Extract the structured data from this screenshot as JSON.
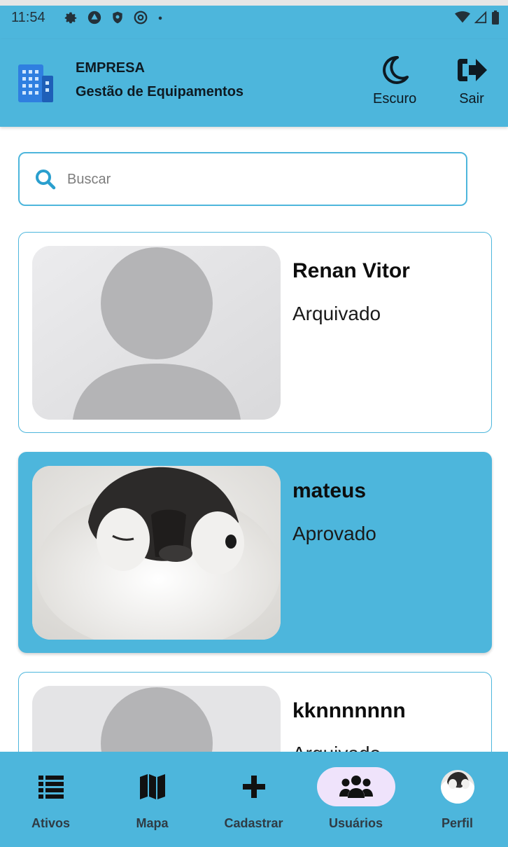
{
  "status_bar": {
    "time": "11:54"
  },
  "header": {
    "title": "EMPRESA",
    "subtitle": "Gestão de Equipamentos",
    "dark_label": "Escuro",
    "exit_label": "Sair"
  },
  "search": {
    "placeholder": "Buscar",
    "value": ""
  },
  "users": [
    {
      "name": "Renan Vitor",
      "status": "Arquivado",
      "avatar": "default-person"
    },
    {
      "name": "mateus",
      "status": "Aprovado",
      "avatar": "penguin-photo"
    },
    {
      "name": "kknnnnnnn",
      "status": "Arquivado",
      "avatar": "default-person"
    }
  ],
  "nav": {
    "items": [
      {
        "label": "Ativos",
        "icon": "list-icon"
      },
      {
        "label": "Mapa",
        "icon": "map-icon"
      },
      {
        "label": "Cadastrar",
        "icon": "plus-icon"
      },
      {
        "label": "Usuários",
        "icon": "users-icon"
      },
      {
        "label": "Perfil",
        "icon": "profile-avatar-icon"
      }
    ]
  },
  "colors": {
    "primary": "#4db6dc",
    "active_pill": "#efe3fb",
    "card_border": "#4db6dc"
  }
}
